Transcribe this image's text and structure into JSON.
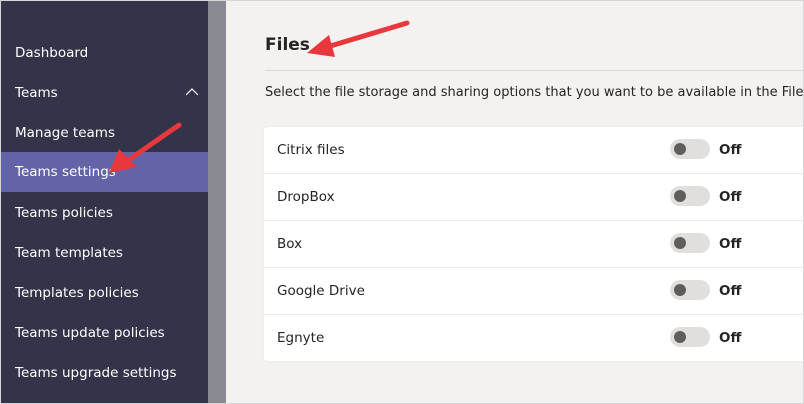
{
  "sidebar": {
    "items": [
      {
        "label": "Dashboard"
      },
      {
        "label": "Teams"
      },
      {
        "label": "Manage teams"
      },
      {
        "label": "Teams settings"
      },
      {
        "label": "Teams policies"
      },
      {
        "label": "Team templates"
      },
      {
        "label": "Templates policies"
      },
      {
        "label": "Teams update policies"
      },
      {
        "label": "Teams upgrade settings"
      }
    ],
    "active_item": "Teams settings",
    "colors": {
      "background": "#33344a",
      "active": "#6264a7"
    }
  },
  "main": {
    "title": "Files",
    "description": "Select the file storage and sharing options that you want to be available in the Files tab.",
    "options": [
      {
        "label": "Citrix files",
        "state": "Off"
      },
      {
        "label": "DropBox",
        "state": "Off"
      },
      {
        "label": "Box",
        "state": "Off"
      },
      {
        "label": "Google Drive",
        "state": "Off"
      },
      {
        "label": "Egnyte",
        "state": "Off"
      }
    ]
  },
  "annotations": {
    "arrow_color": "#e8383d"
  }
}
